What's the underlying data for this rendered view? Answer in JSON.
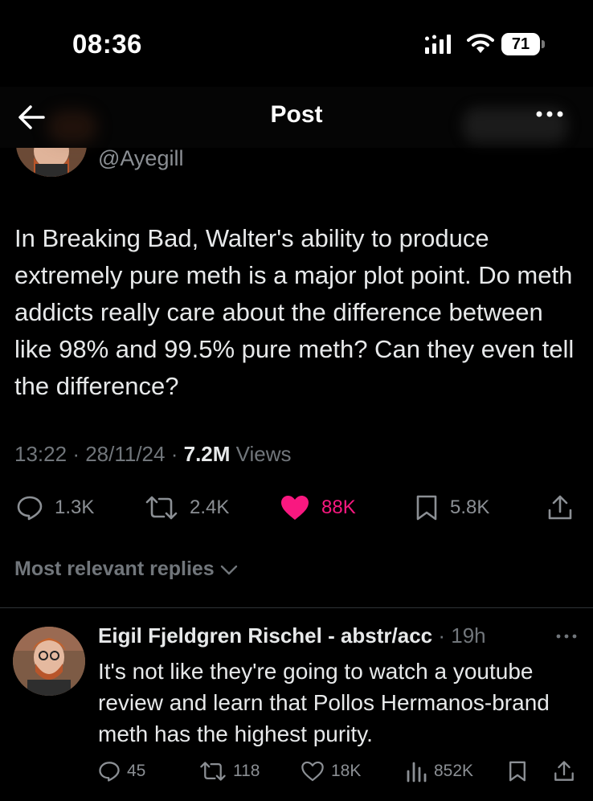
{
  "status_bar": {
    "time": "08:36",
    "battery": "71"
  },
  "header": {
    "title": "Post"
  },
  "author": {
    "handle": "@Ayegill"
  },
  "tweet": {
    "text": "In Breaking Bad, Walter's ability to produce extremely pure meth is a major plot point. Do meth addicts really care about the difference between like 98% and 99.5% pure meth? Can they even tell the difference?",
    "time": "13:22",
    "date": "28/11/24",
    "views_count": "7.2M",
    "views_label": "Views",
    "replies": "1.3K",
    "reposts": "2.4K",
    "likes": "88K",
    "bookmarks": "5.8K"
  },
  "replies_sort": {
    "label": "Most relevant replies"
  },
  "reply": {
    "name": "Eigil Fjeldgren Rischel - abstr/acc",
    "time": "19h",
    "text": "It's not like they're going to watch a youtube review and learn that Pollos Hermanos-brand meth has the highest purity.",
    "replies": "45",
    "reposts": "118",
    "likes": "18K",
    "views": "852K"
  },
  "colors": {
    "like": "#f91880",
    "muted": "#71767b",
    "text": "#e7e9ea"
  }
}
